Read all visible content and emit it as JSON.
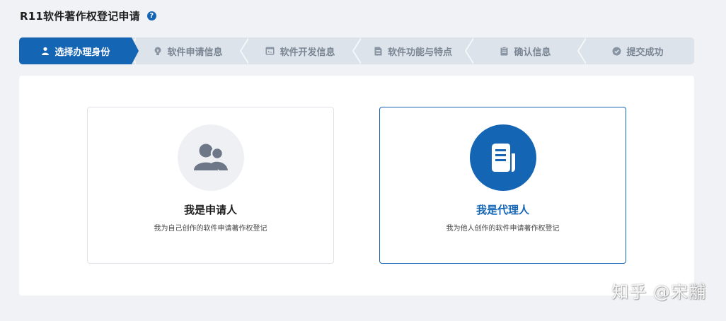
{
  "header": {
    "title": "R11软件著作权登记申请",
    "help_icon": "question-icon"
  },
  "steps": [
    {
      "label": "选择办理身份",
      "icon": "user-icon",
      "active": true
    },
    {
      "label": "软件申请信息",
      "icon": "lightbulb-icon",
      "active": false
    },
    {
      "label": "软件开发信息",
      "icon": "code-window-icon",
      "active": false
    },
    {
      "label": "软件功能与特点",
      "icon": "document-icon",
      "active": false
    },
    {
      "label": "确认信息",
      "icon": "clipboard-icon",
      "active": false
    },
    {
      "label": "提交成功",
      "icon": "check-circle-icon",
      "active": false
    }
  ],
  "cards": [
    {
      "title": "我是申请人",
      "description": "我为自己创作的软件申请著作权登记",
      "icon": "users-icon",
      "selected": false
    },
    {
      "title": "我是代理人",
      "description": "我为他人创作的软件申请著作权登记",
      "icon": "document-stack-icon",
      "selected": true
    }
  ],
  "watermark": "知乎 @宋黼",
  "colors": {
    "primary": "#1565b5",
    "step_inactive_bg": "#dde3ea",
    "step_inactive_text": "#7a8694",
    "icon_gray_circle": "#eef0f3",
    "icon_gray": "#6e7787",
    "page_bg": "#f0f2f5"
  }
}
